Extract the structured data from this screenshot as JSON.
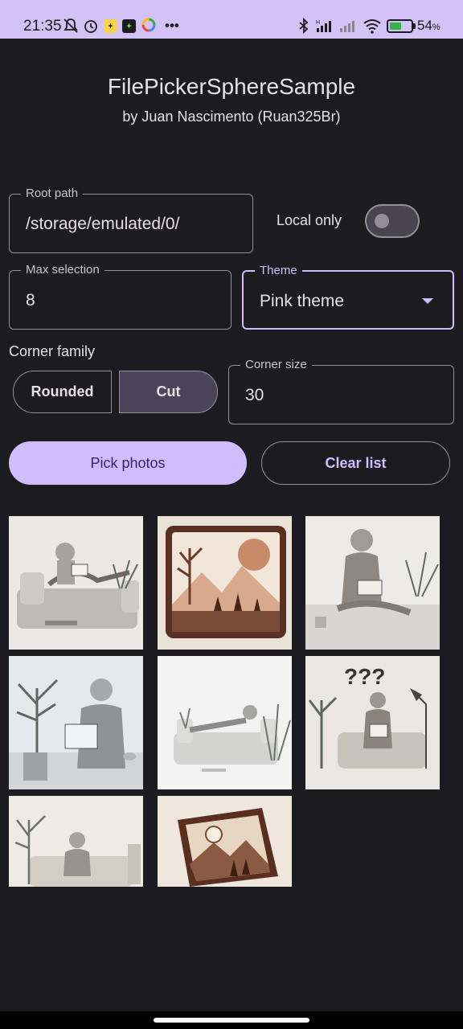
{
  "status_bar": {
    "time": "21:35",
    "more": "•••",
    "battery_percent": "54",
    "battery_unit": "%",
    "icons": [
      "bell-off-icon",
      "alarm-icon",
      "app-badge-icon",
      "app-badge-icon",
      "google-icon",
      "bluetooth-icon",
      "signal-icon",
      "signal-icon",
      "wifi-icon",
      "battery-charging-icon"
    ],
    "battery_level": 0.54
  },
  "header": {
    "title": "FilePickerSphereSample",
    "subtitle": "by Juan Nascimento (Ruan325Br)"
  },
  "root_path": {
    "label": "Root path",
    "value": "/storage/emulated/0/"
  },
  "local_only": {
    "label": "Local only",
    "checked": false
  },
  "max_selection": {
    "label": "Max selection",
    "value": "8"
  },
  "theme": {
    "label": "Theme",
    "value": "Pink theme"
  },
  "corner_family": {
    "label": "Corner family",
    "options": [
      "Rounded",
      "Cut"
    ],
    "selected": "Cut"
  },
  "corner_size": {
    "label": "Corner size",
    "value": "30"
  },
  "actions": {
    "pick_label": "Pick photos",
    "clear_label": "Clear list"
  },
  "photos": [
    "person-reading-on-couch",
    "framed-mountain-landscape",
    "person-reading-seated",
    "person-reading-with-plant",
    "person-lying-on-sofa",
    "person-reading-question-marks",
    "person-reading-on-sofa",
    "book-with-mountain-cover"
  ],
  "colors": {
    "background": "#1c1b1f",
    "status_bar": "#d3c2f5",
    "primary": "#d0bcff",
    "on_primary": "#381e72",
    "secondary_container": "#4a4458",
    "outline": "#938f99"
  }
}
